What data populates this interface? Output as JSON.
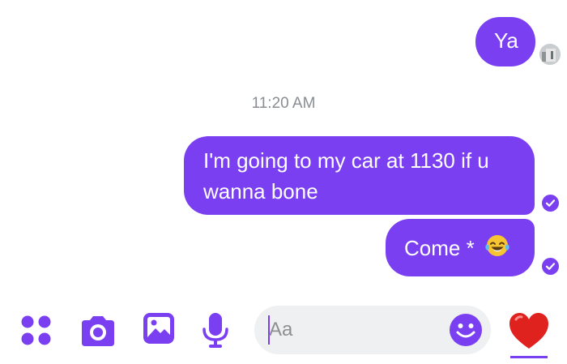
{
  "messages": [
    {
      "id": "m1",
      "text": "Ya",
      "sender": "me"
    },
    {
      "id": "m2",
      "text": "I'm going to my car at 1130 if u wanna bone",
      "sender": "me"
    },
    {
      "id": "m3",
      "text": "Come *",
      "sender": "me",
      "emoji": "laughing-tears-emoji"
    }
  ],
  "timestamp": "11:20 AM",
  "composer": {
    "placeholder": "Aa",
    "icons": [
      "apps-icon",
      "camera-icon",
      "image-icon",
      "microphone-icon",
      "smiley-icon",
      "heart-icon"
    ]
  },
  "colors": {
    "accent": "#7b3ff2",
    "bubble_text": "#ffffff",
    "timestamp": "#8a8d91",
    "input_bg": "#eef0f2",
    "heart": "#e0221f"
  }
}
